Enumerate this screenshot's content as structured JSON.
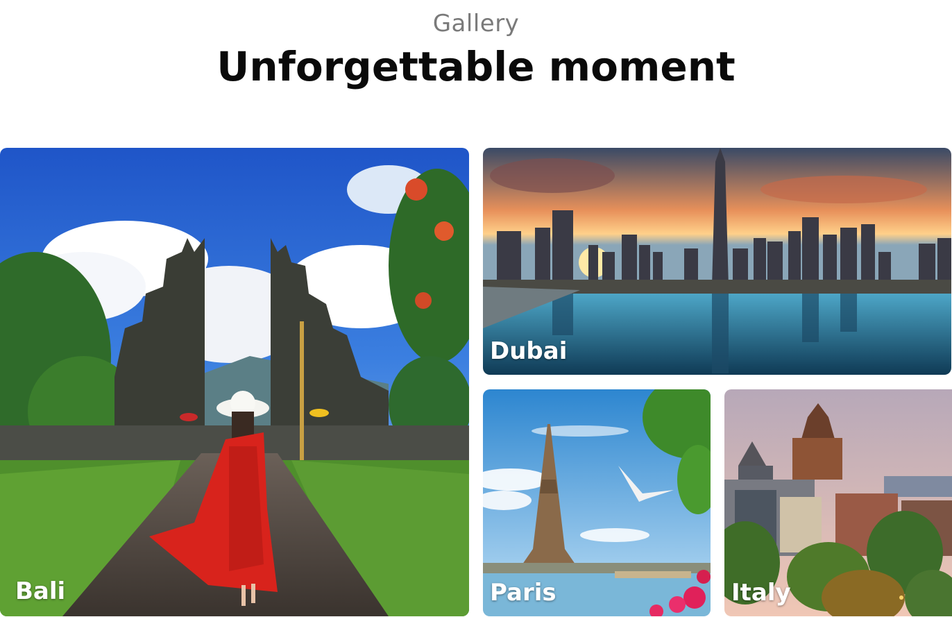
{
  "header": {
    "eyebrow": "Gallery",
    "title": "Unforgettable moment"
  },
  "gallery": {
    "items": [
      {
        "id": "bali",
        "label": "Bali",
        "scene": "temple-gate-woman-red-dress"
      },
      {
        "id": "dubai",
        "label": "Dubai",
        "scene": "skyline-sunset-pool-reflection"
      },
      {
        "id": "paris",
        "label": "Paris",
        "scene": "eiffel-tower-seagull-river"
      },
      {
        "id": "italy",
        "label": "Italy",
        "scene": "castle-hotel-old-town-dusk"
      }
    ]
  }
}
